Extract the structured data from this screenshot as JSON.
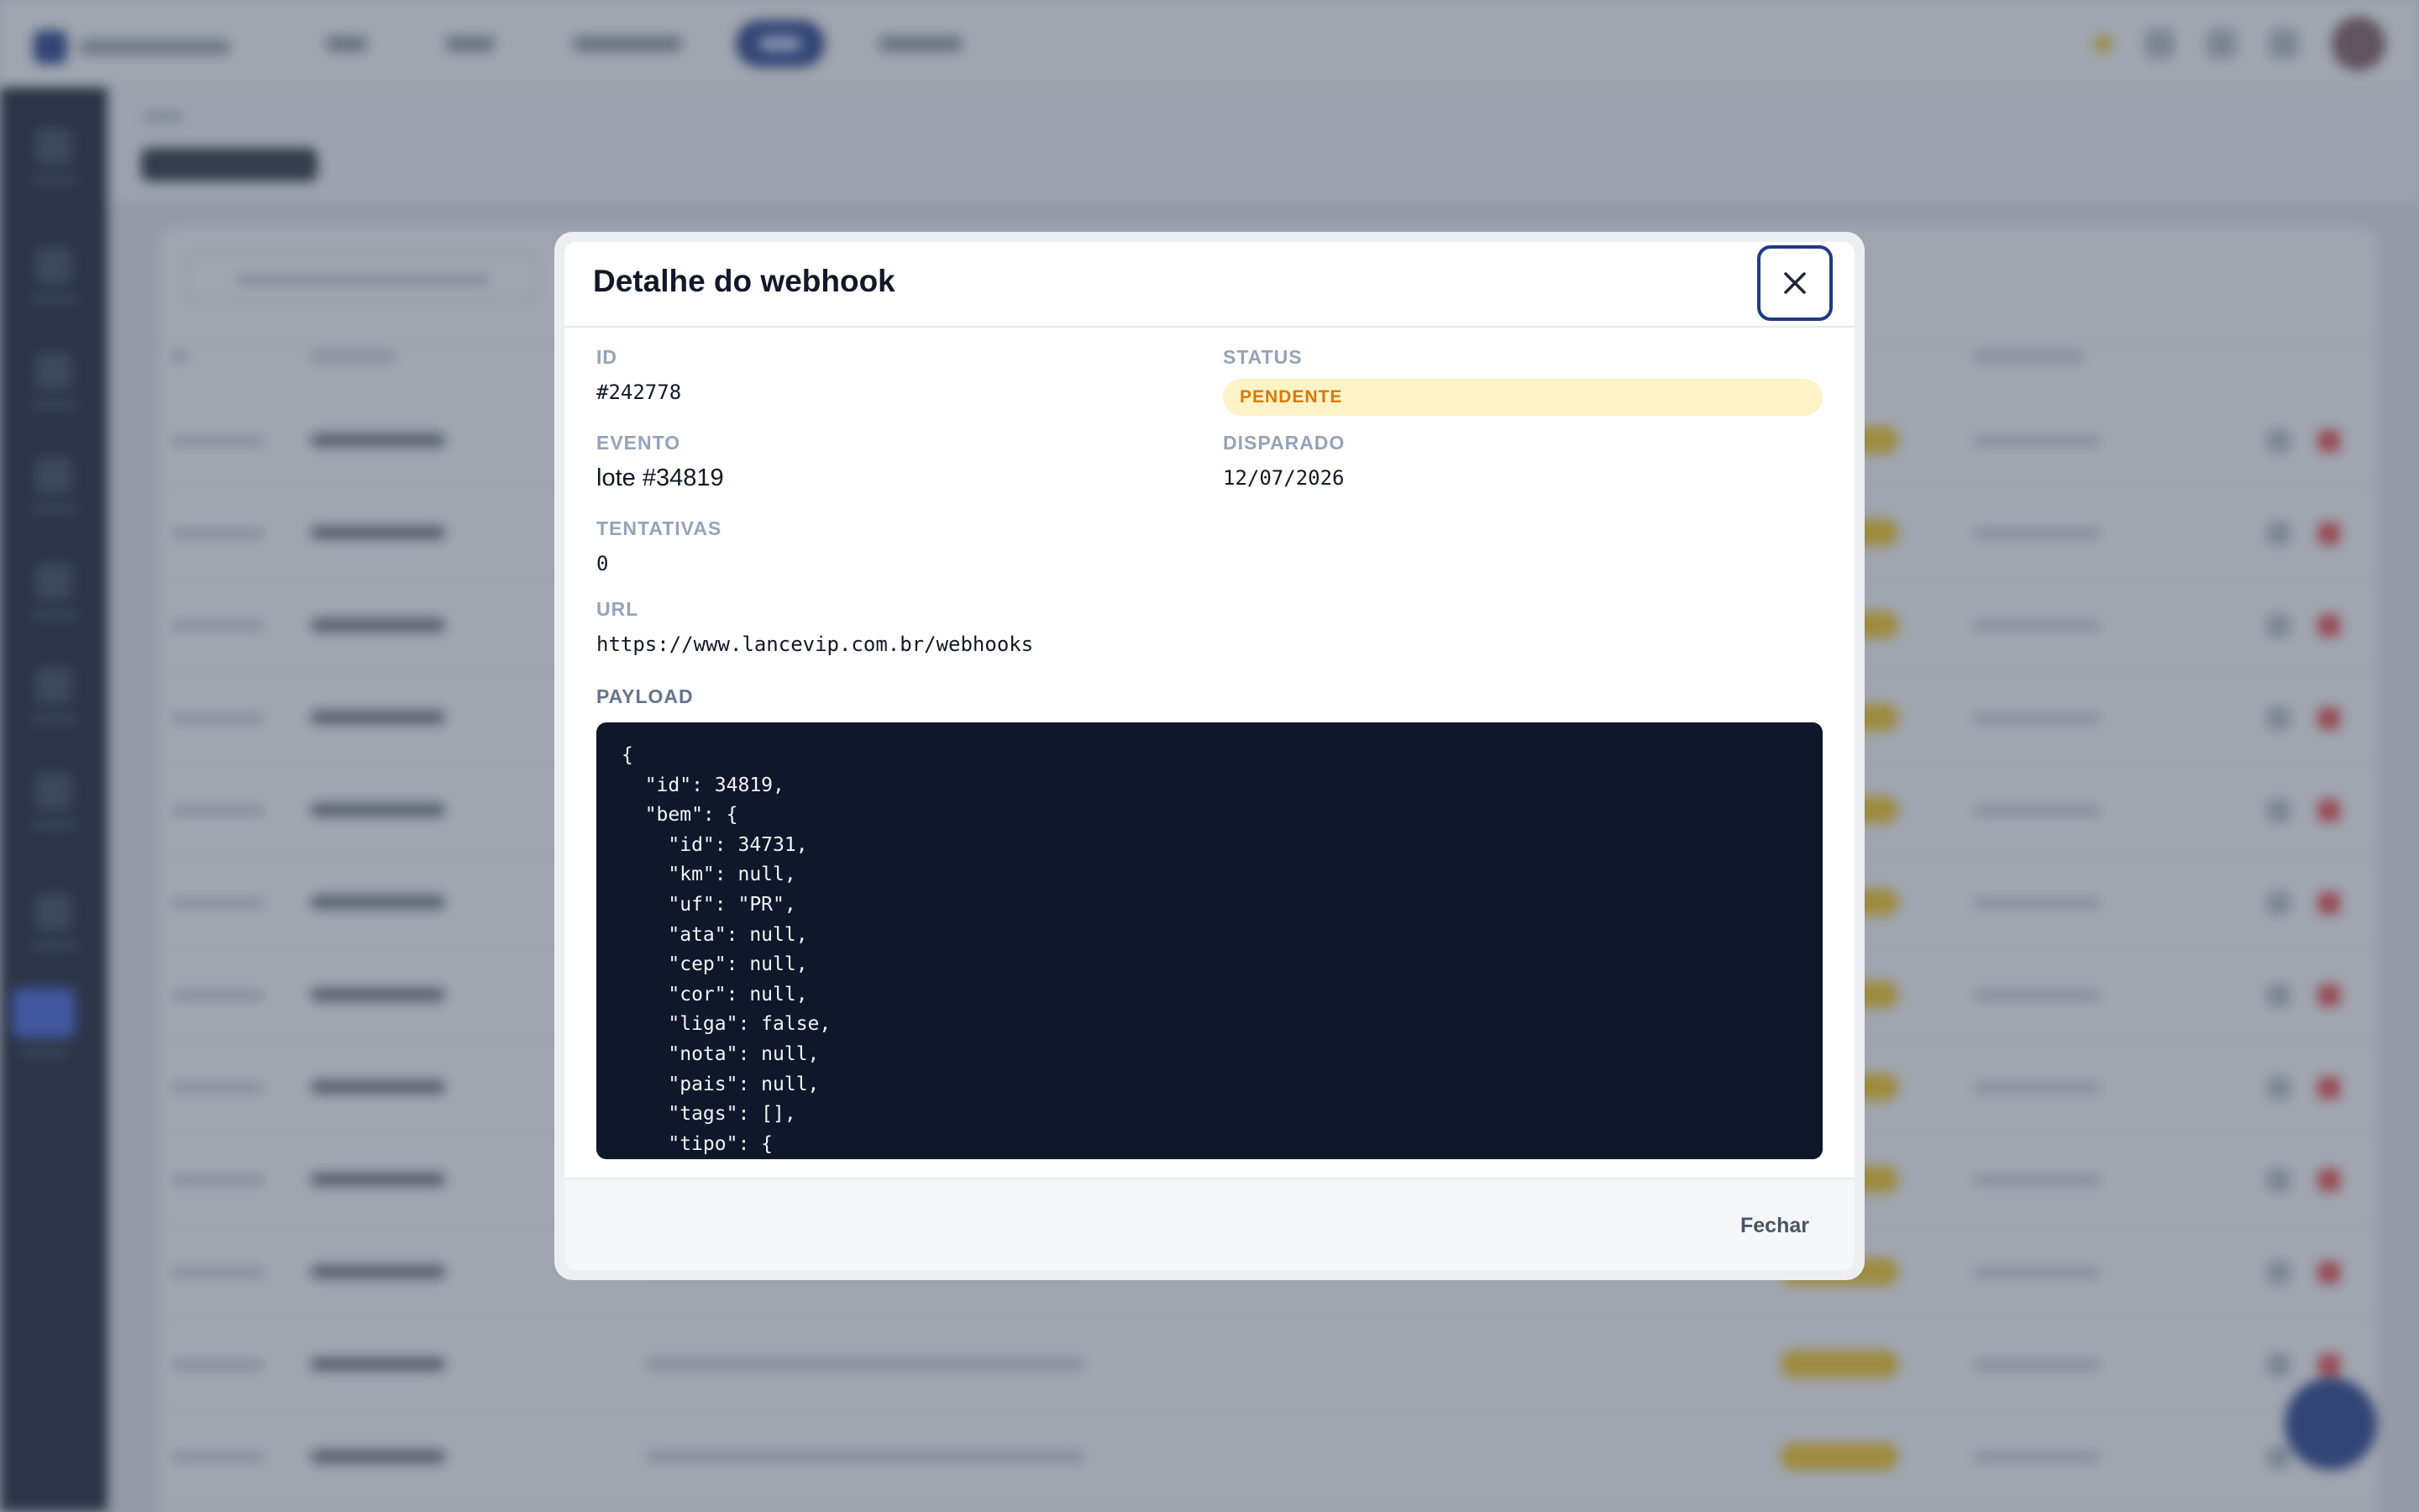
{
  "modal": {
    "title": "Detalhe do webhook",
    "close_icon": "close-icon",
    "fields": {
      "id": {
        "label": "ID",
        "value": "#242778"
      },
      "status": {
        "label": "STATUS",
        "value": "PENDENTE",
        "color": "#d97706",
        "background": "#fef3c7"
      },
      "evento": {
        "label": "EVENTO",
        "value": "lote #34819"
      },
      "disparado": {
        "label": "DISPARADO",
        "value": "12/07/2026"
      },
      "tentativas": {
        "label": "TENTATIVAS",
        "value": "0"
      },
      "url": {
        "label": "URL",
        "value": "https://www.lancevip.com.br/webhooks"
      }
    },
    "payload_label": "PAYLOAD",
    "payload_lines": [
      "{",
      "  \"id\": 34819,",
      "  \"bem\": {",
      "    \"id\": 34731,",
      "    \"km\": null,",
      "    \"uf\": \"PR\",",
      "    \"ata\": null,",
      "    \"cep\": null,",
      "    \"cor\": null,",
      "    \"liga\": false,",
      "    \"nota\": null,",
      "    \"pais\": null,",
      "    \"tags\": [],",
      "    \"tipo\": {"
    ],
    "footer_button": "Fechar"
  },
  "colors": {
    "accent": "#1e3a8a",
    "code_background": "#0f172a",
    "overlay": "rgba(71,80,100,0.52)"
  }
}
